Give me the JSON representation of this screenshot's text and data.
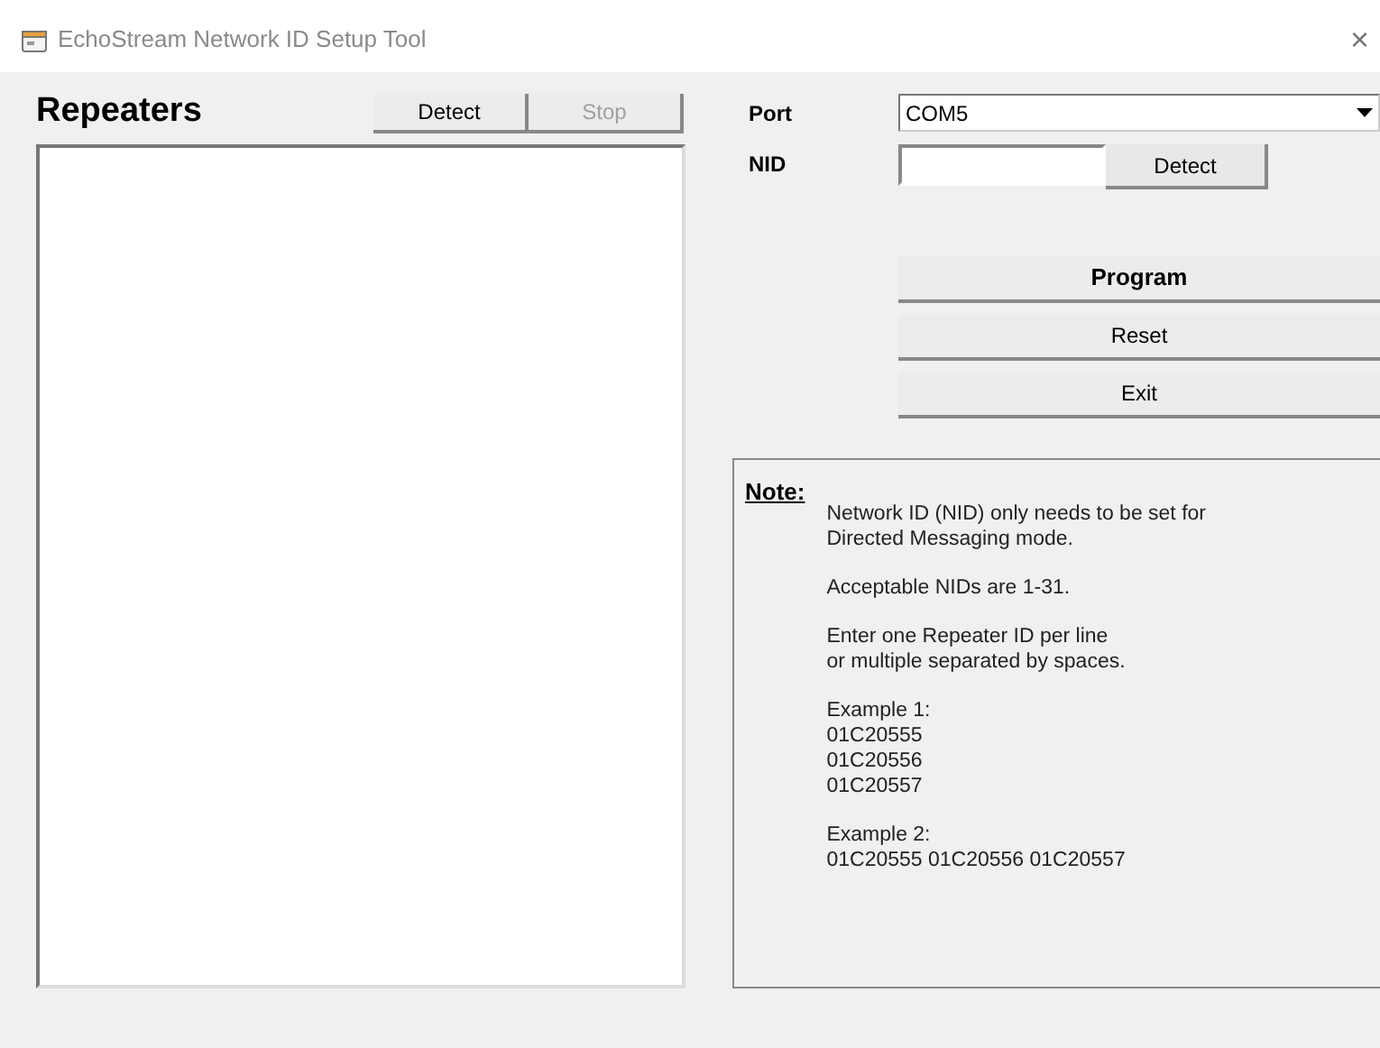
{
  "window": {
    "title": "EchoStream Network ID Setup Tool",
    "close": "×"
  },
  "repeaters": {
    "title": "Repeaters",
    "buttons": [
      {
        "label": "Detect",
        "disabled": false
      },
      {
        "label": "Stop",
        "disabled": true
      }
    ]
  },
  "port": {
    "label": "Port",
    "value": "COM5"
  },
  "nid": {
    "label": "NID",
    "button": "Detect"
  },
  "actions": [
    {
      "label": "Program",
      "default": true
    },
    {
      "label": "Reset",
      "default": false
    },
    {
      "label": "Exit",
      "default": false
    }
  ],
  "note": {
    "title": "Note:",
    "paragraphs": [
      [
        "Network ID (NID) only needs to be set for",
        "Directed Messaging mode."
      ],
      [
        "Acceptable NIDs are 1-31."
      ],
      [
        "Enter one Repeater ID per line",
        "or multiple separated by spaces."
      ],
      [
        "Example 1:",
        "01C20555",
        "01C20556",
        "01C20557"
      ],
      [
        "Example 2:",
        "01C20555 01C20556 01C20557"
      ]
    ]
  }
}
